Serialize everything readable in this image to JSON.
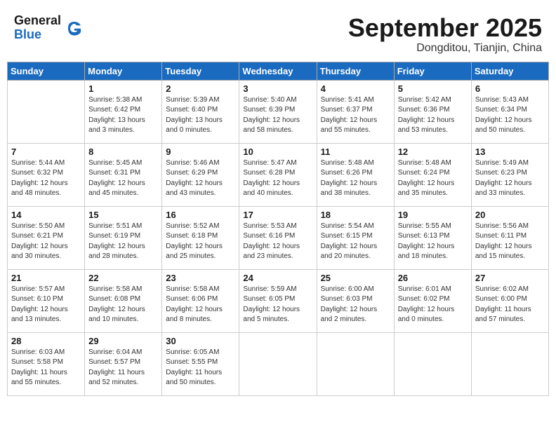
{
  "header": {
    "logo_line1": "General",
    "logo_line2": "Blue",
    "month": "September 2025",
    "location": "Dongditou, Tianjin, China"
  },
  "weekdays": [
    "Sunday",
    "Monday",
    "Tuesday",
    "Wednesday",
    "Thursday",
    "Friday",
    "Saturday"
  ],
  "weeks": [
    [
      {
        "day": "",
        "sunrise": "",
        "sunset": "",
        "daylight": ""
      },
      {
        "day": "1",
        "sunrise": "Sunrise: 5:38 AM",
        "sunset": "Sunset: 6:42 PM",
        "daylight": "Daylight: 13 hours and 3 minutes."
      },
      {
        "day": "2",
        "sunrise": "Sunrise: 5:39 AM",
        "sunset": "Sunset: 6:40 PM",
        "daylight": "Daylight: 13 hours and 0 minutes."
      },
      {
        "day": "3",
        "sunrise": "Sunrise: 5:40 AM",
        "sunset": "Sunset: 6:39 PM",
        "daylight": "Daylight: 12 hours and 58 minutes."
      },
      {
        "day": "4",
        "sunrise": "Sunrise: 5:41 AM",
        "sunset": "Sunset: 6:37 PM",
        "daylight": "Daylight: 12 hours and 55 minutes."
      },
      {
        "day": "5",
        "sunrise": "Sunrise: 5:42 AM",
        "sunset": "Sunset: 6:36 PM",
        "daylight": "Daylight: 12 hours and 53 minutes."
      },
      {
        "day": "6",
        "sunrise": "Sunrise: 5:43 AM",
        "sunset": "Sunset: 6:34 PM",
        "daylight": "Daylight: 12 hours and 50 minutes."
      }
    ],
    [
      {
        "day": "7",
        "sunrise": "Sunrise: 5:44 AM",
        "sunset": "Sunset: 6:32 PM",
        "daylight": "Daylight: 12 hours and 48 minutes."
      },
      {
        "day": "8",
        "sunrise": "Sunrise: 5:45 AM",
        "sunset": "Sunset: 6:31 PM",
        "daylight": "Daylight: 12 hours and 45 minutes."
      },
      {
        "day": "9",
        "sunrise": "Sunrise: 5:46 AM",
        "sunset": "Sunset: 6:29 PM",
        "daylight": "Daylight: 12 hours and 43 minutes."
      },
      {
        "day": "10",
        "sunrise": "Sunrise: 5:47 AM",
        "sunset": "Sunset: 6:28 PM",
        "daylight": "Daylight: 12 hours and 40 minutes."
      },
      {
        "day": "11",
        "sunrise": "Sunrise: 5:48 AM",
        "sunset": "Sunset: 6:26 PM",
        "daylight": "Daylight: 12 hours and 38 minutes."
      },
      {
        "day": "12",
        "sunrise": "Sunrise: 5:48 AM",
        "sunset": "Sunset: 6:24 PM",
        "daylight": "Daylight: 12 hours and 35 minutes."
      },
      {
        "day": "13",
        "sunrise": "Sunrise: 5:49 AM",
        "sunset": "Sunset: 6:23 PM",
        "daylight": "Daylight: 12 hours and 33 minutes."
      }
    ],
    [
      {
        "day": "14",
        "sunrise": "Sunrise: 5:50 AM",
        "sunset": "Sunset: 6:21 PM",
        "daylight": "Daylight: 12 hours and 30 minutes."
      },
      {
        "day": "15",
        "sunrise": "Sunrise: 5:51 AM",
        "sunset": "Sunset: 6:19 PM",
        "daylight": "Daylight: 12 hours and 28 minutes."
      },
      {
        "day": "16",
        "sunrise": "Sunrise: 5:52 AM",
        "sunset": "Sunset: 6:18 PM",
        "daylight": "Daylight: 12 hours and 25 minutes."
      },
      {
        "day": "17",
        "sunrise": "Sunrise: 5:53 AM",
        "sunset": "Sunset: 6:16 PM",
        "daylight": "Daylight: 12 hours and 23 minutes."
      },
      {
        "day": "18",
        "sunrise": "Sunrise: 5:54 AM",
        "sunset": "Sunset: 6:15 PM",
        "daylight": "Daylight: 12 hours and 20 minutes."
      },
      {
        "day": "19",
        "sunrise": "Sunrise: 5:55 AM",
        "sunset": "Sunset: 6:13 PM",
        "daylight": "Daylight: 12 hours and 18 minutes."
      },
      {
        "day": "20",
        "sunrise": "Sunrise: 5:56 AM",
        "sunset": "Sunset: 6:11 PM",
        "daylight": "Daylight: 12 hours and 15 minutes."
      }
    ],
    [
      {
        "day": "21",
        "sunrise": "Sunrise: 5:57 AM",
        "sunset": "Sunset: 6:10 PM",
        "daylight": "Daylight: 12 hours and 13 minutes."
      },
      {
        "day": "22",
        "sunrise": "Sunrise: 5:58 AM",
        "sunset": "Sunset: 6:08 PM",
        "daylight": "Daylight: 12 hours and 10 minutes."
      },
      {
        "day": "23",
        "sunrise": "Sunrise: 5:58 AM",
        "sunset": "Sunset: 6:06 PM",
        "daylight": "Daylight: 12 hours and 8 minutes."
      },
      {
        "day": "24",
        "sunrise": "Sunrise: 5:59 AM",
        "sunset": "Sunset: 6:05 PM",
        "daylight": "Daylight: 12 hours and 5 minutes."
      },
      {
        "day": "25",
        "sunrise": "Sunrise: 6:00 AM",
        "sunset": "Sunset: 6:03 PM",
        "daylight": "Daylight: 12 hours and 2 minutes."
      },
      {
        "day": "26",
        "sunrise": "Sunrise: 6:01 AM",
        "sunset": "Sunset: 6:02 PM",
        "daylight": "Daylight: 12 hours and 0 minutes."
      },
      {
        "day": "27",
        "sunrise": "Sunrise: 6:02 AM",
        "sunset": "Sunset: 6:00 PM",
        "daylight": "Daylight: 11 hours and 57 minutes."
      }
    ],
    [
      {
        "day": "28",
        "sunrise": "Sunrise: 6:03 AM",
        "sunset": "Sunset: 5:58 PM",
        "daylight": "Daylight: 11 hours and 55 minutes."
      },
      {
        "day": "29",
        "sunrise": "Sunrise: 6:04 AM",
        "sunset": "Sunset: 5:57 PM",
        "daylight": "Daylight: 11 hours and 52 minutes."
      },
      {
        "day": "30",
        "sunrise": "Sunrise: 6:05 AM",
        "sunset": "Sunset: 5:55 PM",
        "daylight": "Daylight: 11 hours and 50 minutes."
      },
      {
        "day": "",
        "sunrise": "",
        "sunset": "",
        "daylight": ""
      },
      {
        "day": "",
        "sunrise": "",
        "sunset": "",
        "daylight": ""
      },
      {
        "day": "",
        "sunrise": "",
        "sunset": "",
        "daylight": ""
      },
      {
        "day": "",
        "sunrise": "",
        "sunset": "",
        "daylight": ""
      }
    ]
  ]
}
